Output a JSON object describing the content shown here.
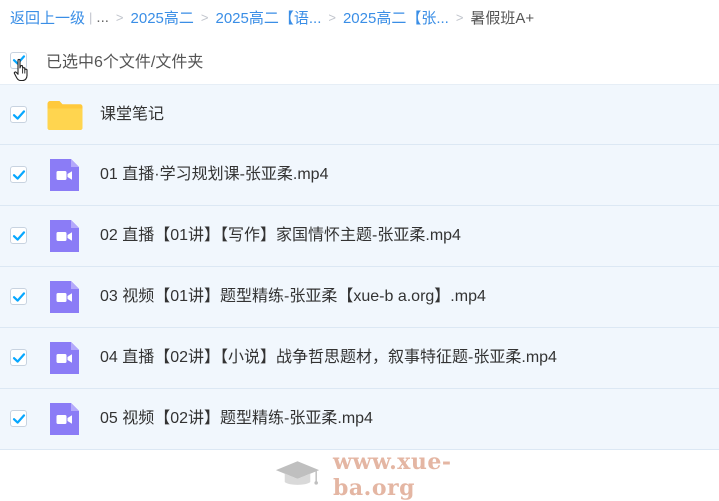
{
  "breadcrumb": {
    "back_label": "返回上一级",
    "more_label": "...",
    "items": [
      "2025高二",
      "2025高二【语...",
      "2025高二【张..."
    ],
    "current": "暑假班A+"
  },
  "selection": {
    "label": "已选中6个文件/文件夹",
    "checked": true
  },
  "files": [
    {
      "name": "课堂笔记",
      "type": "folder",
      "icon": "folder-icon",
      "checked": true
    },
    {
      "name": "01 直播·学习规划课-张亚柔.mp4",
      "type": "video",
      "icon": "video-file-icon",
      "checked": true
    },
    {
      "name": "02 直播【01讲】【写作】家国情怀主题-张亚柔.mp4",
      "type": "video",
      "icon": "video-file-icon",
      "checked": true
    },
    {
      "name": "03 视频【01讲】题型精练-张亚柔【xue-b a.org】.mp4",
      "type": "video",
      "icon": "video-file-icon",
      "checked": true
    },
    {
      "name": "04 直播【02讲】【小说】战争哲思题材，叙事特征题-张亚柔.mp4",
      "type": "video",
      "icon": "video-file-icon",
      "checked": true
    },
    {
      "name": "05 视频【02讲】题型精练-张亚柔.mp4",
      "type": "video",
      "icon": "video-file-icon",
      "checked": true
    }
  ],
  "watermark": {
    "text": "www.xue-ba.org"
  },
  "colors": {
    "link": "#3a8ee6",
    "check": "#06a7ff",
    "row_bg": "#f1f7fd",
    "folder": "#ffd04c",
    "video_icon": "#8b7cf6"
  }
}
